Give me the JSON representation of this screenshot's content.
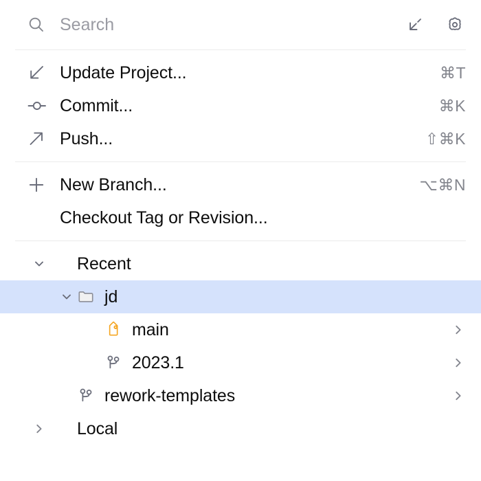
{
  "search": {
    "placeholder": "Search",
    "value": "",
    "icon": "search-icon"
  },
  "header_actions": [
    {
      "name": "collapse-all-icon",
      "tooltip": "Collapse All"
    },
    {
      "name": "gear-icon",
      "tooltip": "Settings"
    }
  ],
  "sections": {
    "vcs_actions": [
      {
        "label": "Update Project...",
        "shortcut": "⌘T",
        "icon": "update-project-icon"
      },
      {
        "label": "Commit...",
        "shortcut": "⌘K",
        "icon": "commit-icon"
      },
      {
        "label": "Push...",
        "shortcut": "⇧⌘K",
        "icon": "push-icon"
      }
    ],
    "branch_actions": [
      {
        "label": "New Branch...",
        "shortcut": "⌥⌘N",
        "icon": "plus-icon"
      },
      {
        "label": "Checkout Tag or Revision...",
        "shortcut": "",
        "icon": ""
      }
    ],
    "tree": [
      {
        "label": "Recent",
        "indent": 0,
        "twisty": "expanded",
        "icon": "",
        "selected": false,
        "arrow": false
      },
      {
        "label": "jd",
        "indent": 1,
        "twisty": "expanded",
        "icon": "folder-icon",
        "selected": true,
        "arrow": false
      },
      {
        "label": "main",
        "indent": 2,
        "twisty": "none",
        "icon": "tag-icon",
        "selected": false,
        "arrow": true
      },
      {
        "label": "2023.1",
        "indent": 2,
        "twisty": "none",
        "icon": "branch-icon",
        "selected": false,
        "arrow": true
      },
      {
        "label": "rework-templates",
        "indent": 1,
        "twisty": "none",
        "icon": "branch-icon",
        "selected": false,
        "arrow": true
      },
      {
        "label": "Local",
        "indent": 0,
        "twisty": "collapsed",
        "icon": "",
        "selected": false,
        "arrow": false
      }
    ]
  },
  "colors": {
    "selection": "#d5e2fc",
    "tag_icon": "#f5a623",
    "icon_gray": "#6a6d7a",
    "text": "#0d0d0d",
    "muted_text": "#83858d",
    "separator": "#ebebeb"
  }
}
